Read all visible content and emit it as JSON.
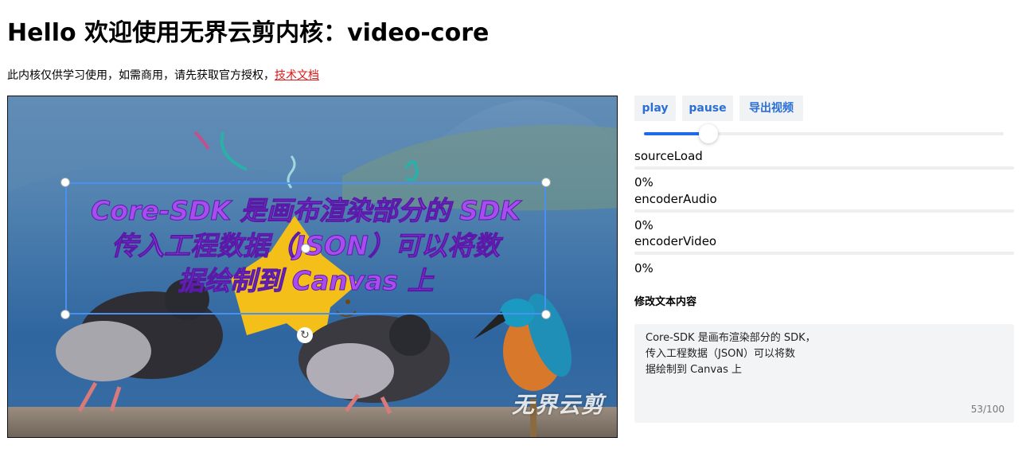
{
  "header": {
    "title": "Hello 欢迎使用无界云剪内核：video-core",
    "notice": "此内核仅供学习使用，如需商用，请先获取官方授权，",
    "doc_link": "技术文档"
  },
  "canvas": {
    "caption_lines": [
      "Core-SDK 是画布渲染部分的 SDK",
      "传入工程数据（JSON）可以将数",
      "据绘制到 Canvas 上"
    ],
    "watermark": "无界云剪"
  },
  "controls": {
    "play_label": "play",
    "pause_label": "pause",
    "export_label": "导出视频",
    "playback_progress": 0.18
  },
  "progress": [
    {
      "label": "sourceLoad",
      "value": "0%",
      "fraction": 0
    },
    {
      "label": "encoderAudio",
      "value": "0%",
      "fraction": 0
    },
    {
      "label": "encoderVideo",
      "value": "0%",
      "fraction": 0
    }
  ],
  "editor": {
    "section_title": "修改文本内容",
    "text": "Core-SDK 是画布渲染部分的 SDK，\n传入工程数据（JSON）可以将数\n据绘制到 Canvas 上",
    "counter": "53/100"
  },
  "colors": {
    "accent": "#1f6ae8",
    "link": "#e01818",
    "caption_fill": "#a84cf0",
    "selection_border": "#4a90f0"
  }
}
